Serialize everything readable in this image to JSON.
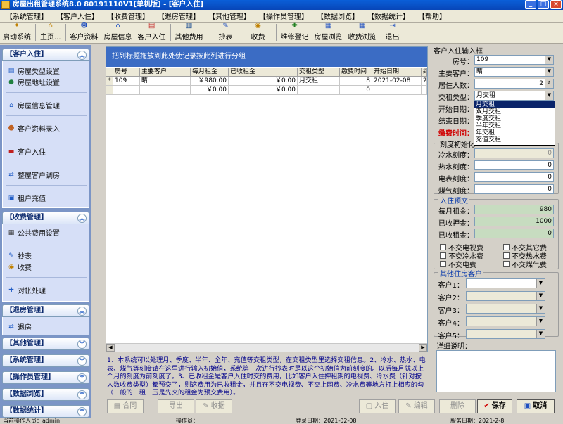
{
  "window": {
    "title": "房屋出租管理系统8.0  80191110V1[单机版] - [客户入住]",
    "buttons": [
      "_",
      "□",
      "×"
    ]
  },
  "menubar": [
    "【系统管理】",
    "【客户入住】",
    "【收费管理】",
    "【退房管理】",
    "【其他管理】",
    "【操作员管理】",
    "【数据浏览】",
    "【数据统计】",
    "【帮助】"
  ],
  "toolbar": [
    {
      "label": "启动系统",
      "icon": "key-icon"
    },
    {
      "label": "主页...",
      "icon": "home-icon"
    },
    {
      "label": "客户资料",
      "icon": "person-icon"
    },
    {
      "label": "房屋信息",
      "icon": "house-icon"
    },
    {
      "label": "客户入住",
      "icon": "checkin-icon"
    },
    {
      "label": "其他费用",
      "icon": "book-icon"
    },
    {
      "label": "抄表",
      "icon": "meter-icon"
    },
    {
      "label": "收费",
      "icon": "money-icon"
    },
    {
      "label": "维修登记",
      "icon": "tools-icon"
    },
    {
      "label": "房屋浏览",
      "icon": "browse-icon"
    },
    {
      "label": "收费浏览",
      "icon": "browse-money-icon"
    },
    {
      "label": "退出",
      "icon": "exit-icon"
    }
  ],
  "sidebar": {
    "groups": [
      {
        "title": "【客户入住】",
        "items": [
          "房屋类型设置",
          "房屋地址设置",
          "房屋信息管理",
          "客户资料录入",
          "客户入住",
          "整屋客户调房",
          "租户充值"
        ]
      },
      {
        "title": "【收费管理】",
        "items": [
          "公共费用设置",
          "抄表",
          "收费",
          "对帐处理"
        ]
      },
      {
        "title": "【退房管理】",
        "items": [
          "退房"
        ]
      },
      {
        "title": "【其他管理】",
        "items": []
      },
      {
        "title": "【系统管理】",
        "items": []
      },
      {
        "title": "【操作员管理】",
        "items": []
      },
      {
        "title": "【数据浏览】",
        "items": []
      },
      {
        "title": "【数据统计】",
        "items": []
      }
    ]
  },
  "grid": {
    "group_hint": "把列标题拖放到此处使记录按此列进行分组",
    "columns": [
      "房号",
      "主要客户",
      "每月租金",
      "已收租金",
      "交租类型",
      "缴费时间",
      "开始日期",
      "结"
    ],
    "rows": [
      {
        "marker": "*",
        "cells": [
          "109",
          "睛",
          "￥980.00",
          "￥0.00",
          "月交租",
          "8",
          "2021-02-08",
          "2"
        ]
      },
      {
        "marker": "",
        "cells": [
          "",
          "",
          "￥0.00",
          "￥0.00",
          "",
          "0",
          "",
          ""
        ]
      }
    ]
  },
  "note": "1、本系统可以处理月、季度、半年、全年、充值等交租类型，在交租类型里选择交租信息。2、冷水、热水、电表、煤气等刻度请在这里进行输入初始值，系统第一次进行抄表时是以这个初始值为前刻度的。以后每月就以上个月的刻度为前刻度了。3、已收租金是客户入住时交的费用，比如客户入住押租期的电视费、冷水费（针对按人数收费类型）都预交了，则这费用为已收租金，并且在不交电视费、不交上网费、冷水费等地方打上相应的勾（一般的一租一压是先交的租金为预交费用）。",
  "form": {
    "title": "客户入住输入框",
    "room_no": {
      "label": "房号：",
      "value": "109"
    },
    "main_customer": {
      "label": "主要客户：",
      "value": "睛"
    },
    "residents": {
      "label": "居住人数：",
      "value": "2"
    },
    "rent_type": {
      "label": "交租类型：",
      "value": "月交租"
    },
    "start_date": {
      "label": "开始日期："
    },
    "end_date": {
      "label": "结束日期："
    },
    "pay_time": {
      "label": "缴费时间："
    },
    "rent_type_options": [
      "月交租",
      "双月交租",
      "季度交租",
      "半年交租",
      "年交租",
      "充值交租"
    ],
    "meter": {
      "title": "刻度初始化",
      "cold_water": {
        "label": "冷水刻度：",
        "value": "0"
      },
      "hot_water": {
        "label": "热水刻度：",
        "value": "0"
      },
      "electric": {
        "label": "电表刻度：",
        "value": "0"
      },
      "gas": {
        "label": "煤气刻度：",
        "value": "0"
      }
    },
    "prepay": {
      "title": "入住预交",
      "monthly_rent": {
        "label": "每月租金：",
        "value": "980"
      },
      "deposit": {
        "label": "已收押金：",
        "value": "1000"
      },
      "received_rent": {
        "label": "已收租金：",
        "value": "0"
      },
      "checks": [
        "不交电视费",
        "不交其它费",
        "不交冷水费",
        "不交热水费",
        "不交电费",
        "不交煤气费"
      ]
    },
    "others": {
      "title": "其他住房客户",
      "labels": [
        "客户1：",
        "客户2：",
        "客户3：",
        "客户4：",
        "客户5："
      ]
    },
    "detail_label": "详细说明："
  },
  "buttons": {
    "contract": "合同",
    "export": "导出",
    "receipt": "收据",
    "checkin": "入住",
    "edit": "编辑",
    "delete": "删除",
    "save": "保存",
    "cancel": "取消"
  },
  "status": [
    "当前操作人员：admin",
    "操作员：",
    "登录日期：2021-02-08",
    "服务日期：2021-2-8"
  ]
}
